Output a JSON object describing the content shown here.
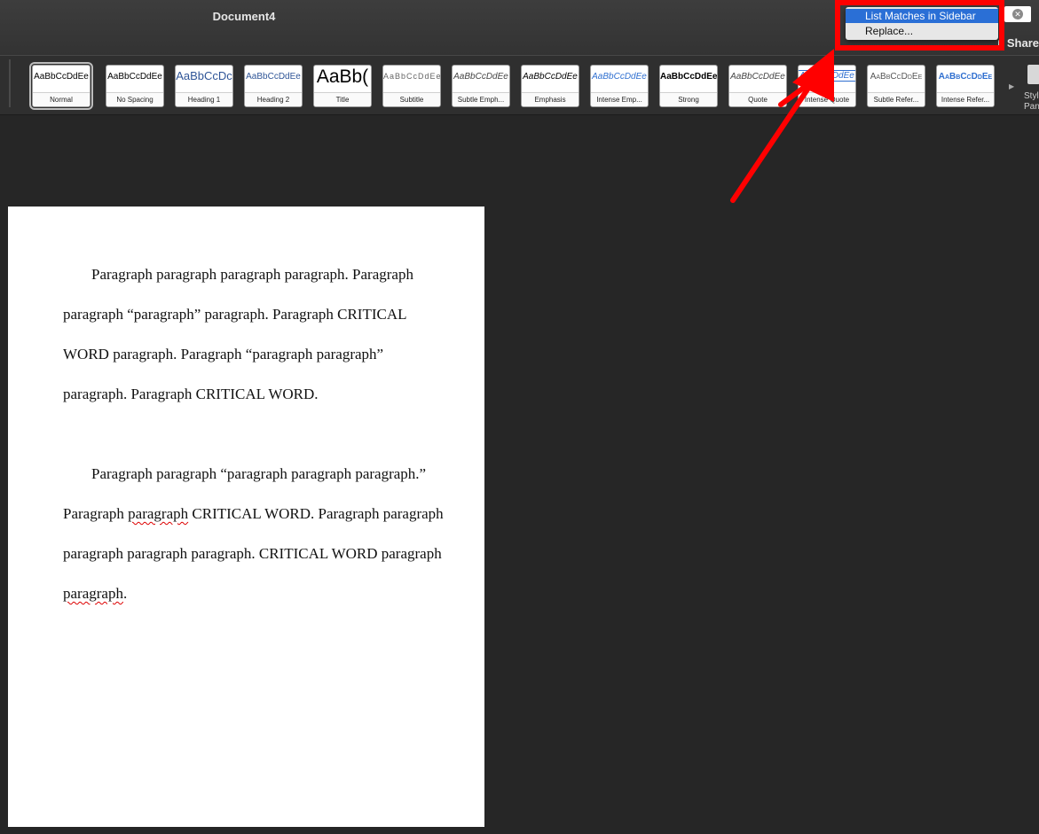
{
  "window": {
    "title": "Document4",
    "share_label": "Share"
  },
  "ribbon": {
    "styles": [
      {
        "sample": "AaBbCcDdEe",
        "label": "Normal",
        "selected": true
      },
      {
        "sample": "AaBbCcDdEe",
        "label": "No Spacing"
      },
      {
        "sample": "AaBbCcDc",
        "label": "Heading 1"
      },
      {
        "sample": "AaBbCcDdEe",
        "label": "Heading 2"
      },
      {
        "sample": "AaBb(",
        "label": "Title"
      },
      {
        "sample": "AaBbCcDdEe",
        "label": "Subtitle"
      },
      {
        "sample": "AaBbCcDdEe",
        "label": "Subtle Emph..."
      },
      {
        "sample": "AaBbCcDdEe",
        "label": "Emphasis"
      },
      {
        "sample": "AaBbCcDdEe",
        "label": "Intense Emp..."
      },
      {
        "sample": "AaBbCcDdEe",
        "label": "Strong"
      },
      {
        "sample": "AaBbCcDdEe",
        "label": "Quote"
      },
      {
        "sample": "AaBbCcDdEe",
        "label": "Intense Quote"
      },
      {
        "sample": "AaBbCcDdEe",
        "label": "Subtle Refer..."
      },
      {
        "sample": "AaBbCcDdEe",
        "label": "Intense Refer..."
      }
    ],
    "styles_pane_label": "Styles Pane"
  },
  "search_menu": {
    "items": [
      {
        "label": "List Matches in Sidebar",
        "highlighted": true
      },
      {
        "label": "Replace..."
      }
    ]
  },
  "document": {
    "p1": {
      "text": "Paragraph paragraph paragraph paragraph. Paragraph paragraph “paragraph” paragraph. Paragraph CRITICAL WORD paragraph. Paragraph “paragraph paragraph” paragraph. Paragraph CRITICAL WORD."
    },
    "p2": {
      "a": "Paragraph paragraph “paragraph paragraph paragraph.” Paragraph ",
      "b": "paragraph",
      "c": " CRITICAL WORD. Paragraph paragraph paragraph paragraph paragraph. CRITICAL WORD paragraph ",
      "d": "paragraph",
      "e": "."
    }
  },
  "colors": {
    "annotation": "#ff0000",
    "menu_highlight": "#2a6fd6"
  }
}
